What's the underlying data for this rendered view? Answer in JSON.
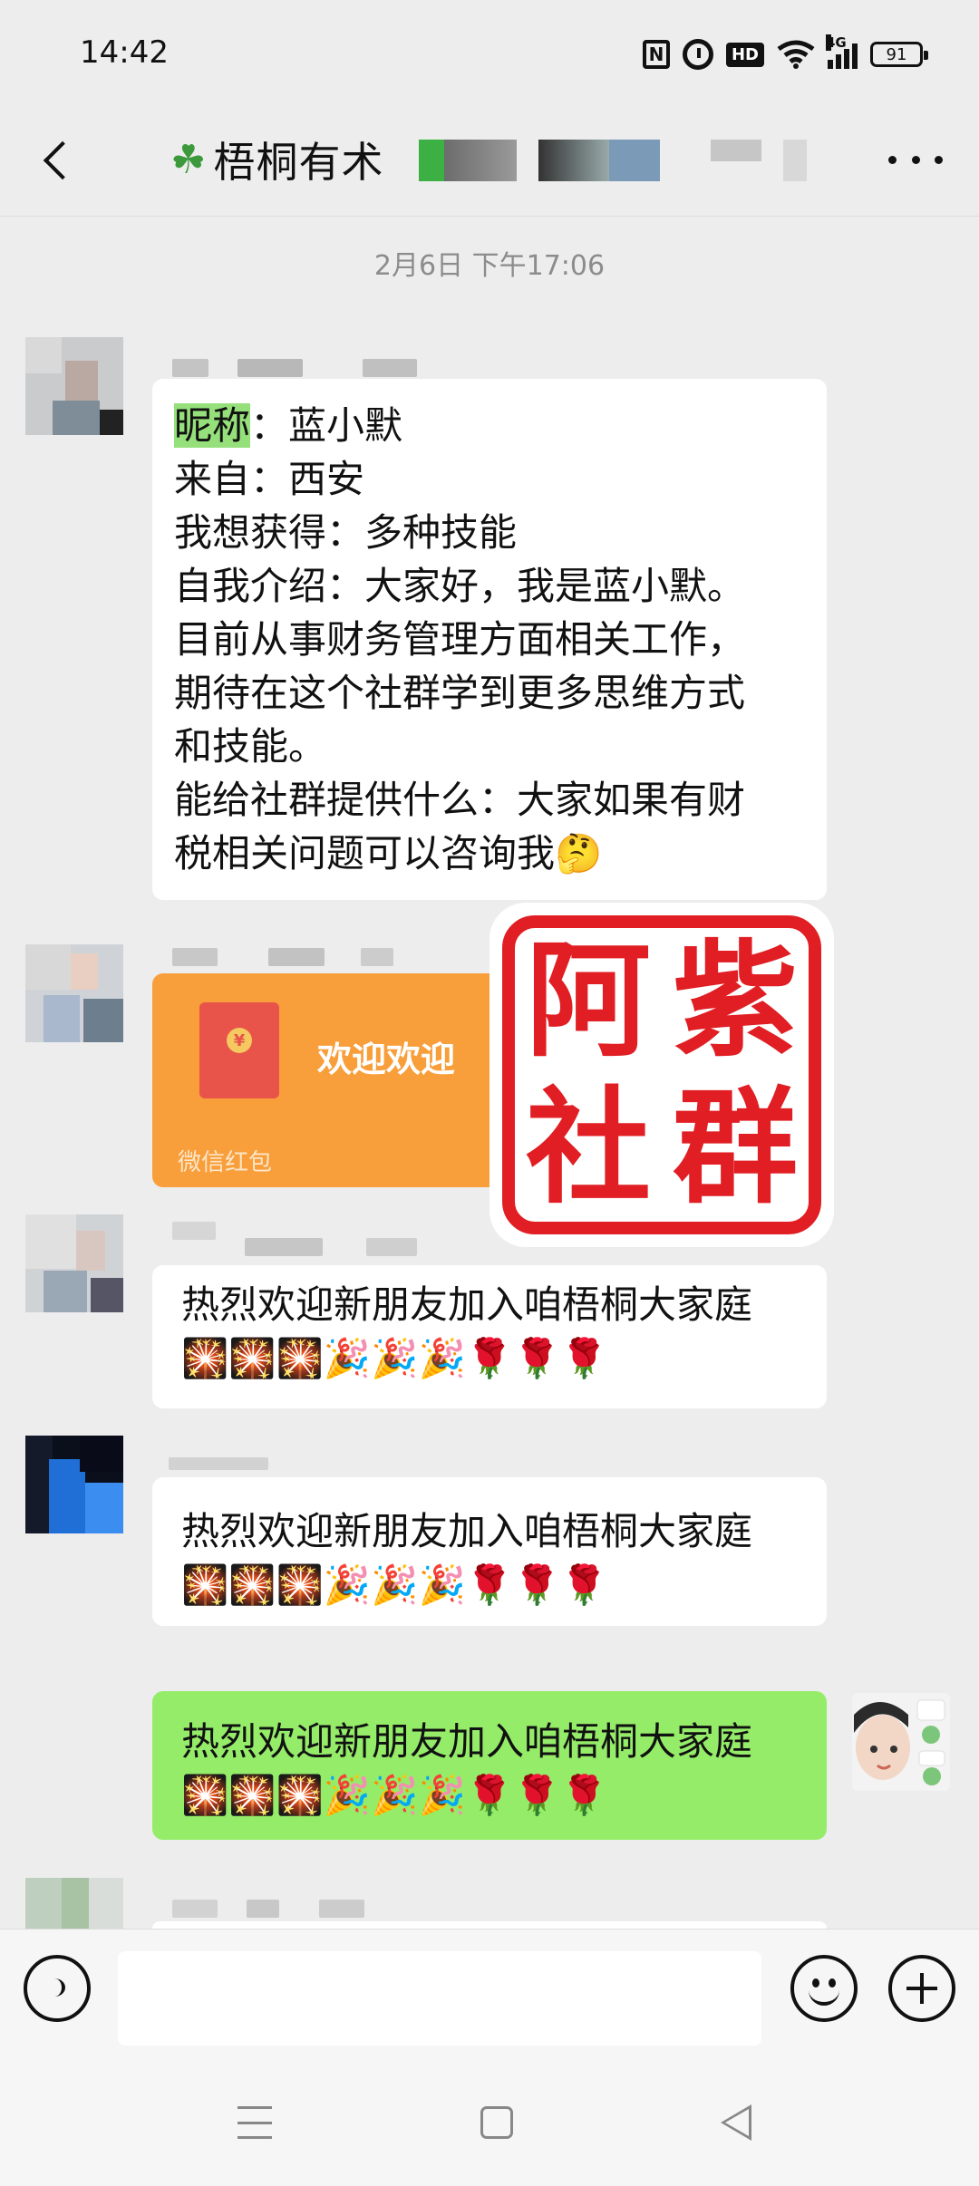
{
  "status_bar": {
    "time": "14:42",
    "network": "4G",
    "hd": "HD",
    "battery": "91"
  },
  "header": {
    "title": "梧桐有术"
  },
  "chat": {
    "timestamp": "2月6日 下午17:06",
    "intro": {
      "l1_key": "昵称",
      "l1_rest": "：蓝小默",
      "l2": "来自：西安",
      "l3": "我想获得：多种技能",
      "l4": "自我介绍：大家好，我是蓝小默。",
      "l5": "目前从事财务管理方面相关工作，",
      "l6": "期待在这个社群学到更多思维方式",
      "l7": "和技能。",
      "l8": "能给社群提供什么：大家如果有财",
      "l9": "税相关问题可以咨询我🤔"
    },
    "red_packet": {
      "text": "欢迎欢迎",
      "label": "微信红包",
      "coin": "¥"
    },
    "welcome_1": {
      "text": "热烈欢迎新朋友加入咱梧桐大家庭",
      "emojis": "🎇🎇🎇🎉🎉🎉🌹🌹🌹"
    },
    "welcome_2": {
      "text": "热烈欢迎新朋友加入咱梧桐大家庭",
      "emojis": "🎇🎇🎇🎉🎉🎉🌹🌹🌹"
    },
    "welcome_mine": {
      "text": "热烈欢迎新朋友加入咱梧桐大家庭",
      "emojis": "🎇🎇🎇🎉🎉🎉🌹🌹🌹"
    }
  },
  "watermark": {
    "chars": [
      "阿",
      "紫",
      "社",
      "群"
    ]
  },
  "input": {
    "value": ""
  },
  "colors": {
    "bubble_mine": "#95ec69",
    "bubble_other": "#ffffff",
    "red_packet": "#f89e3a",
    "stamp": "#e01e23",
    "background": "#ededed"
  }
}
